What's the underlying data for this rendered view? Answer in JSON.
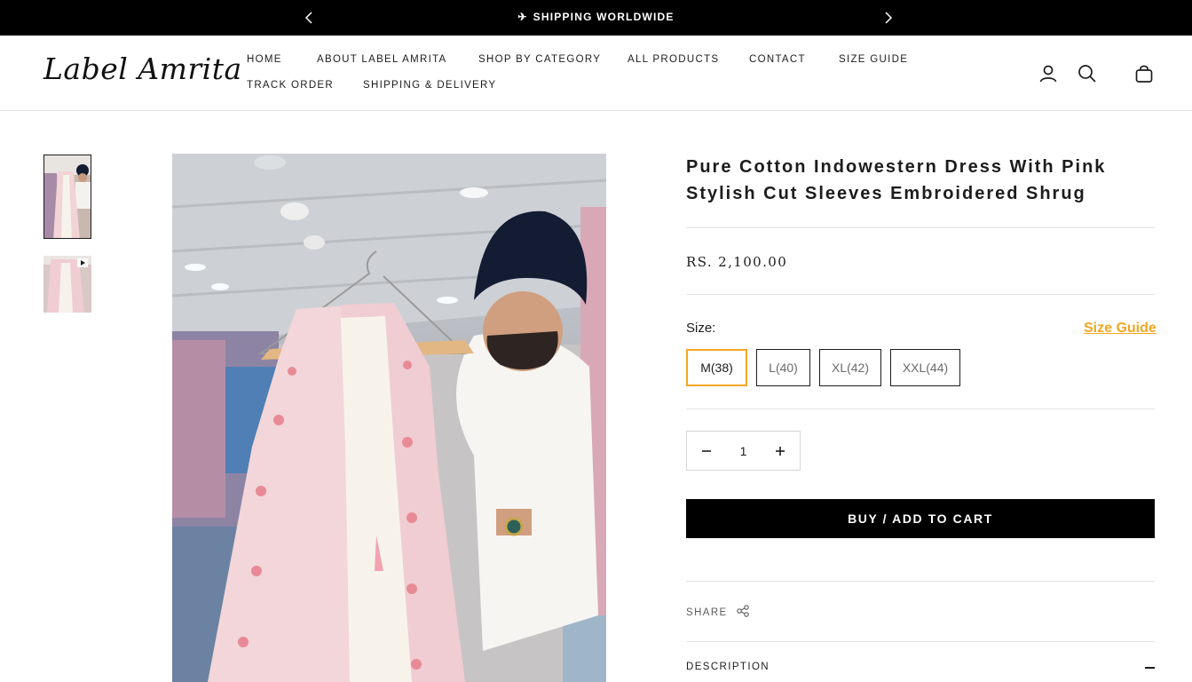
{
  "announcement": {
    "text": "SHIPPING WORLDWIDE",
    "icon": "airplane-icon",
    "prev_icon": "chevron-left-icon",
    "next_icon": "chevron-right-icon"
  },
  "header": {
    "logo": "Label Amrita",
    "nav": [
      {
        "label": "HOME"
      },
      {
        "label": "ABOUT LABEL AMRITA"
      },
      {
        "label": "SHOP BY CATEGORY"
      },
      {
        "label": "ALL PRODUCTS"
      },
      {
        "label": "CONTACT"
      },
      {
        "label": "SIZE GUIDE"
      },
      {
        "label": "TRACK ORDER"
      },
      {
        "label": "SHIPPING & DELIVERY"
      }
    ],
    "icons": [
      "account-icon",
      "search-icon",
      "bag-icon"
    ]
  },
  "gallery": {
    "thumbnails": [
      {
        "kind": "image"
      },
      {
        "kind": "video"
      }
    ]
  },
  "product": {
    "title": "Pure Cotton Indowestern Dress With Pink Stylish Cut Sleeves Embroidered Shrug",
    "price": "RS. 2,100.00",
    "size_label": "Size:",
    "size_guide_link": "Size Guide",
    "sizes": [
      {
        "label": "M(38)",
        "selected": true
      },
      {
        "label": "L(40)",
        "selected": false
      },
      {
        "label": "XL(42)",
        "selected": false
      },
      {
        "label": "XXL(44)",
        "selected": false
      }
    ],
    "quantity": "1",
    "cart_button": "BUY / ADD TO CART",
    "share_label": "SHARE",
    "description_label": "DESCRIPTION"
  },
  "colors": {
    "accent": "#f5a623",
    "black": "#000000",
    "divider": "#e3e3e3"
  }
}
